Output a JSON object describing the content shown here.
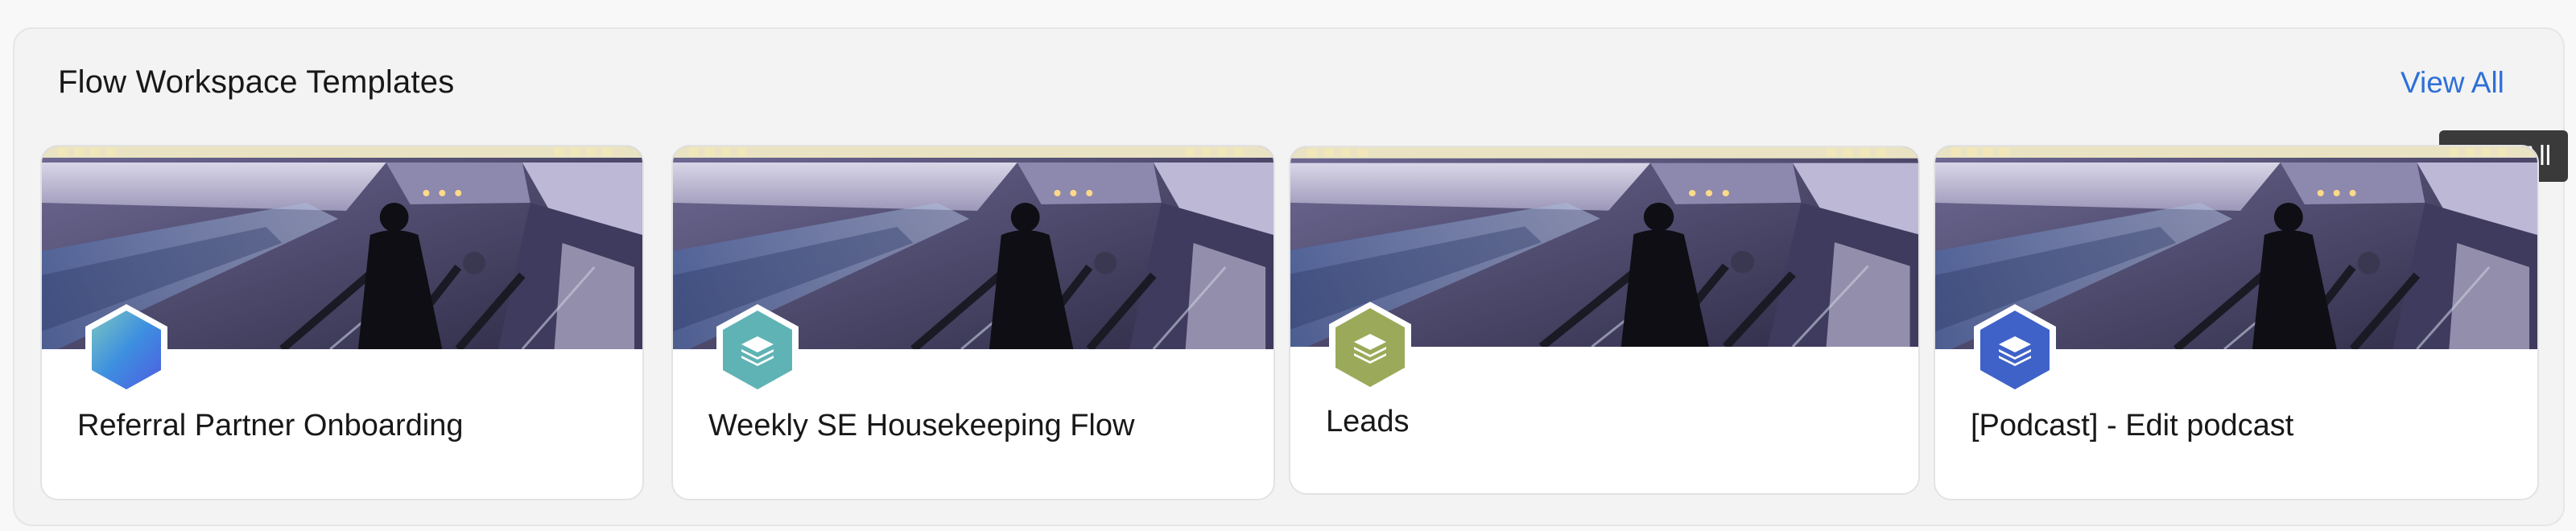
{
  "section": {
    "title": "Flow Workspace Templates",
    "view_all_label": "View All",
    "tooltip": "View All"
  },
  "cards": [
    {
      "title": "Referral Partner Onboarding",
      "icon": "gradient-hexagon-icon",
      "icon_color": "#3d8fe0"
    },
    {
      "title": "Weekly SE Housekeeping Flow",
      "icon": "layers-icon",
      "icon_color": "#5fb3b5"
    },
    {
      "title": "Leads",
      "icon": "layers-icon",
      "icon_color": "#9aaa5a"
    },
    {
      "title": "[Podcast] - Edit podcast",
      "icon": "layers-icon",
      "icon_color": "#3f62c9"
    }
  ]
}
